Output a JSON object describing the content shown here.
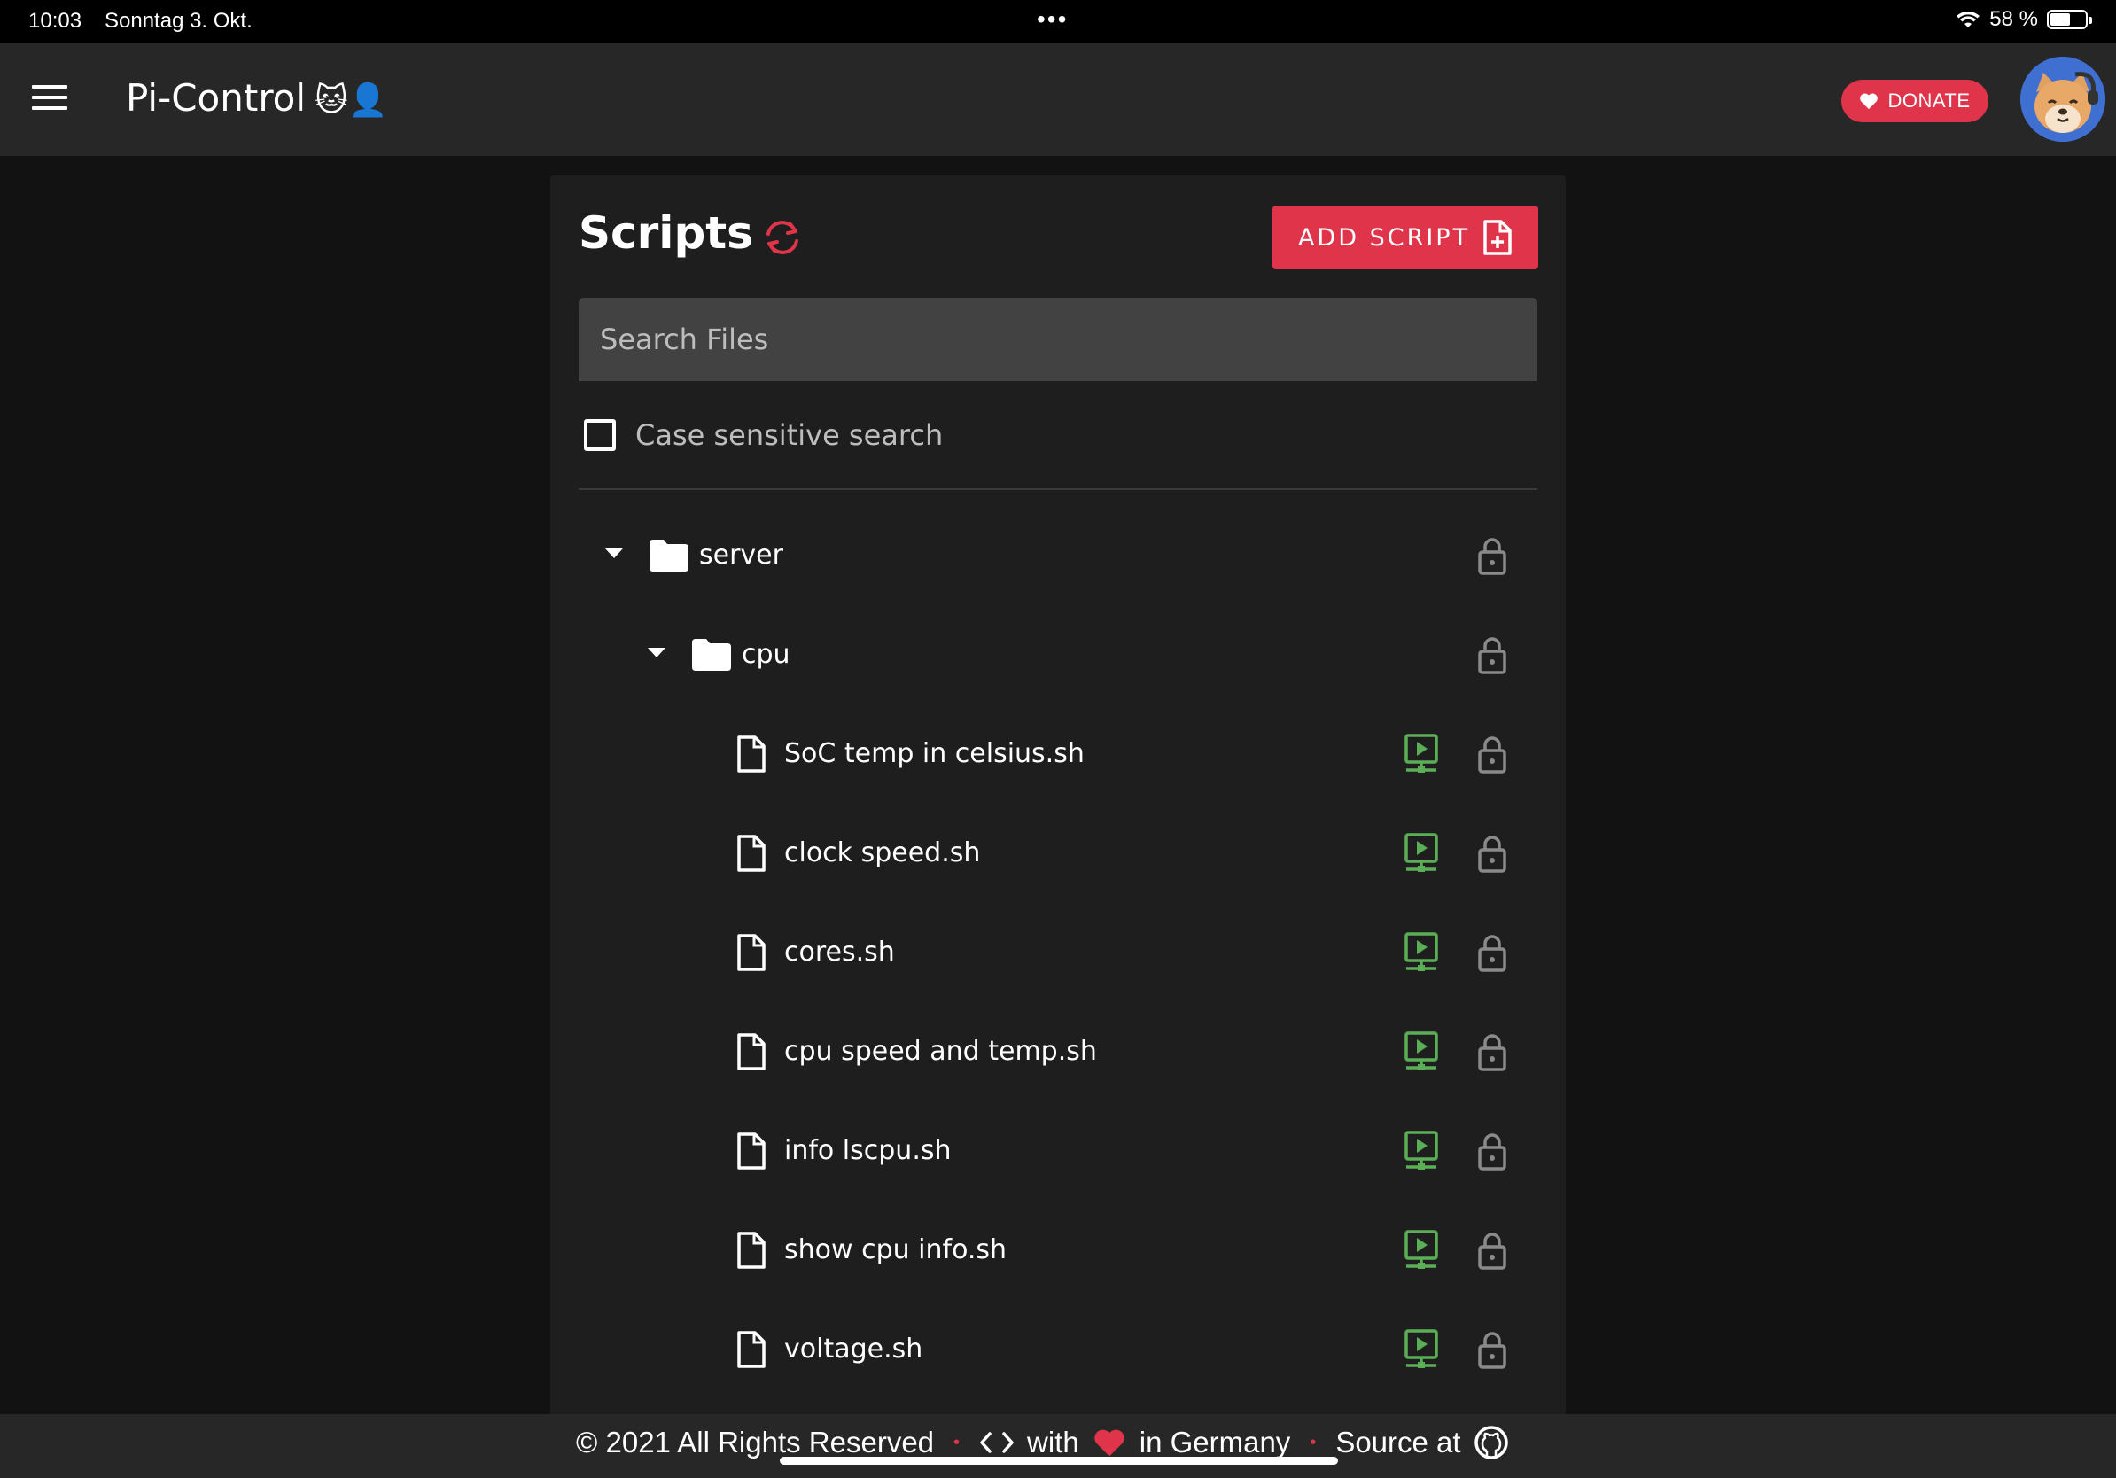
{
  "status_bar": {
    "time": "10:03",
    "date": "Sonntag 3. Okt.",
    "battery": "58 %",
    "battery_level": 0.58,
    "wifi_icon": "wifi-icon"
  },
  "app_bar": {
    "title": "Pi-Control",
    "title_emoji": "🐱👤",
    "donate_label": "DONATE",
    "menu_icon": "menu-icon",
    "avatar_icon": "shiba-avatar"
  },
  "scripts_card": {
    "title": "Scripts",
    "add_button_label": "ADD SCRIPT",
    "search_placeholder": "Search Files",
    "search_value": "",
    "case_sensitive_label": "Case sensitive search",
    "case_sensitive_checked": false
  },
  "tree": {
    "root_folder": "server",
    "sub_folder": "cpu",
    "files": [
      "SoC temp in celsius.sh",
      "clock speed.sh",
      "cores.sh",
      "cpu speed and temp.sh",
      "info lscpu.sh",
      "show cpu info.sh",
      "voltage.sh"
    ]
  },
  "colors": {
    "accent": "#e0344a",
    "run": "#5aae55",
    "lock": "#8a8a8a",
    "background": "#121212",
    "surface": "#1e1e1e",
    "appbar": "#272727"
  },
  "footer": {
    "copyright": "© 2021 All Rights Reserved",
    "with": "with",
    "in_germany": "in Germany",
    "source": "Source at"
  }
}
